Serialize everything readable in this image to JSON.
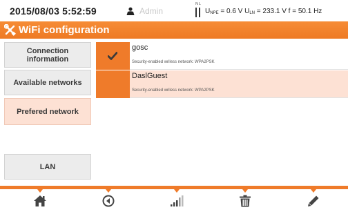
{
  "status_bar": {
    "datetime": "2015/08/03 5:52:59",
    "user": "Admin",
    "nl_label": "N L",
    "upe_label": "U",
    "upe_sub": "NPE",
    "upe_value": " = 0.6 V ",
    "uln_label": "U",
    "uln_sub": "LN",
    "uln_value": " = 233.1 V ",
    "freq": "f = 50.1 Hz"
  },
  "title": {
    "text": "WiFi configuration",
    "icon": "tools-icon"
  },
  "menu": {
    "connection_info_line1": "Connection",
    "connection_info_line2": "information",
    "available_networks": "Available networks",
    "preferred_network": "Prefered network",
    "lan": "LAN"
  },
  "networks": [
    {
      "name": "gosc",
      "security": "Security-enabled wriless network: WPA2PSK",
      "connected": true,
      "selected": false
    },
    {
      "name": "DaslGuest",
      "security": "Security-enabled wriless network: WPA2PSK",
      "connected": false,
      "selected": true
    }
  ],
  "toolbar": {
    "icons": [
      "home-icon",
      "back-icon",
      "signal-icon",
      "delete-icon",
      "edit-icon"
    ]
  },
  "colors": {
    "accent": "#ef7b2a",
    "selected_bg": "#fde1d4",
    "menu_bg": "#ececec",
    "toolbar_icon": "#444444"
  }
}
